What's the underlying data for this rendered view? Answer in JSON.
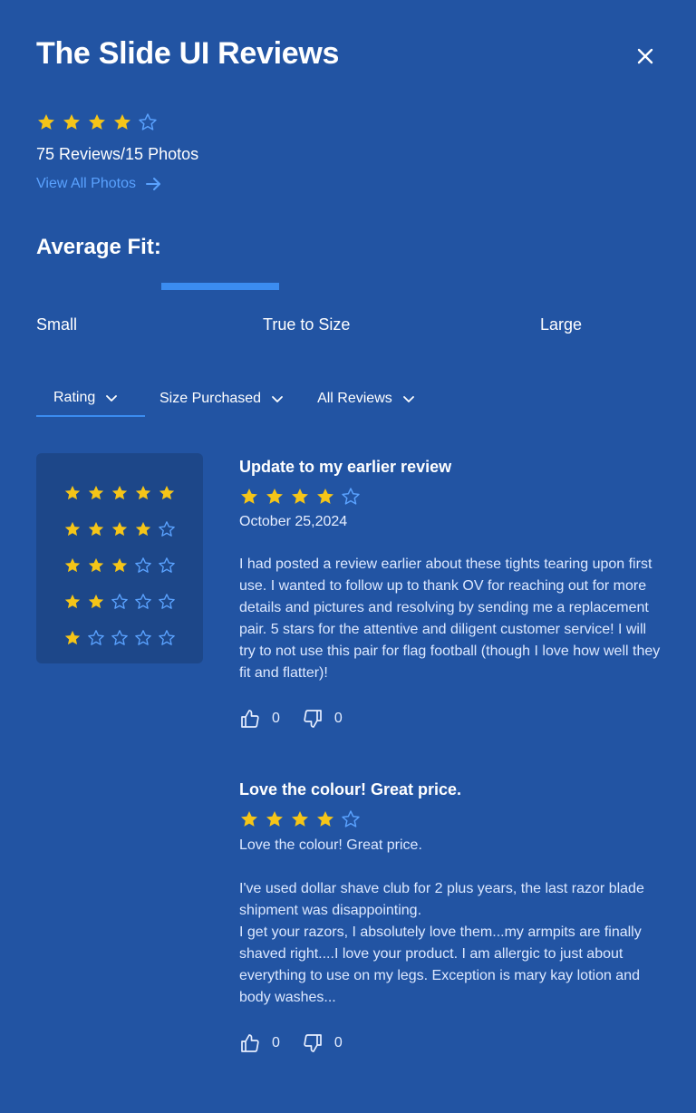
{
  "header": {
    "title": "The Slide UI Reviews",
    "close_icon": "close-icon"
  },
  "summary": {
    "rating": 4,
    "max_rating": 5,
    "reviews_photos": "75 Reviews/15 Photos",
    "view_all_label": "View All Photos"
  },
  "fit": {
    "title": "Average Fit:",
    "labels": [
      "Small",
      "True to Size",
      "Large"
    ],
    "marker_start": 0.2,
    "marker_end": 0.39
  },
  "tabs": [
    {
      "label": "Rating",
      "active": true
    },
    {
      "label": "Size Purchased",
      "active": false
    },
    {
      "label": "All Reviews",
      "active": false
    }
  ],
  "rating_filter": [
    5,
    4,
    3,
    2,
    1
  ],
  "reviews": [
    {
      "title": "Update to my earlier review",
      "rating": 4,
      "date": "October 25,2024",
      "body": "I had posted a review earlier about these tights tearing upon first use. I wanted to follow up to thank OV for reaching out for more details and pictures and resolving by sending me a replacement pair. 5 stars for the attentive and diligent customer service! I will try to not use this pair for flag football (though I love how well they fit and flatter)!",
      "likes": "0",
      "dislikes": "0"
    },
    {
      "title": "Love the colour! Great price.",
      "rating": 4,
      "date": "",
      "body": "Love the colour! Great price.\n\nI've used dollar shave club for 2 plus years, the last razor blade shipment was disappointing.\nI get your razors, I absolutely love them...my armpits are finally shaved right....I love your product. I am allergic to just about everything to use on my legs. Exception is mary kay lotion and body washes...",
      "likes": "0",
      "dislikes": "0"
    }
  ],
  "colors": {
    "background": "#2254a3",
    "star_filled": "#f5c518",
    "star_empty": "#5aa2ff",
    "accent": "#3b8cf0",
    "rating_box": "#1d4789"
  }
}
